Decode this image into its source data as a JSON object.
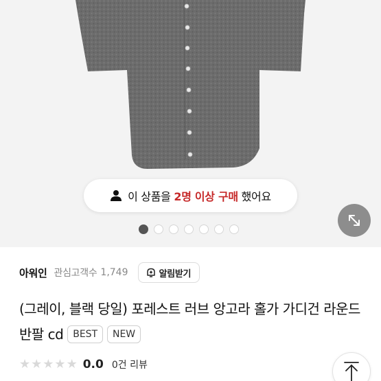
{
  "purchase_notice": {
    "prefix": "이 상품을",
    "highlight": "2명 이상 구매",
    "suffix": "했어요"
  },
  "carousel": {
    "total": 7,
    "active": 0
  },
  "seller": {
    "name": "아워인",
    "follower_label": "관심고객수",
    "follower_count": "1,749",
    "alarm_label": "알림받기"
  },
  "product": {
    "title": "(그레이, 블랙 당일) 포레스트 러브 앙고라 홀가 가디건 라운드 반팔 cd",
    "badges": [
      "BEST",
      "NEW"
    ]
  },
  "rating": {
    "value": "0.0",
    "review_count": "0건 리뷰",
    "stars_filled": 0,
    "stars_total": 5
  },
  "colors": {
    "highlight": "#c62828",
    "garment": "#6e6e6e",
    "star_empty": "#d9d9d9"
  },
  "icons": {
    "notice": "person-icon",
    "expand": "expand-arrows-icon",
    "alarm": "bell-plus-icon",
    "scroll_top": "arrow-up-icon"
  }
}
